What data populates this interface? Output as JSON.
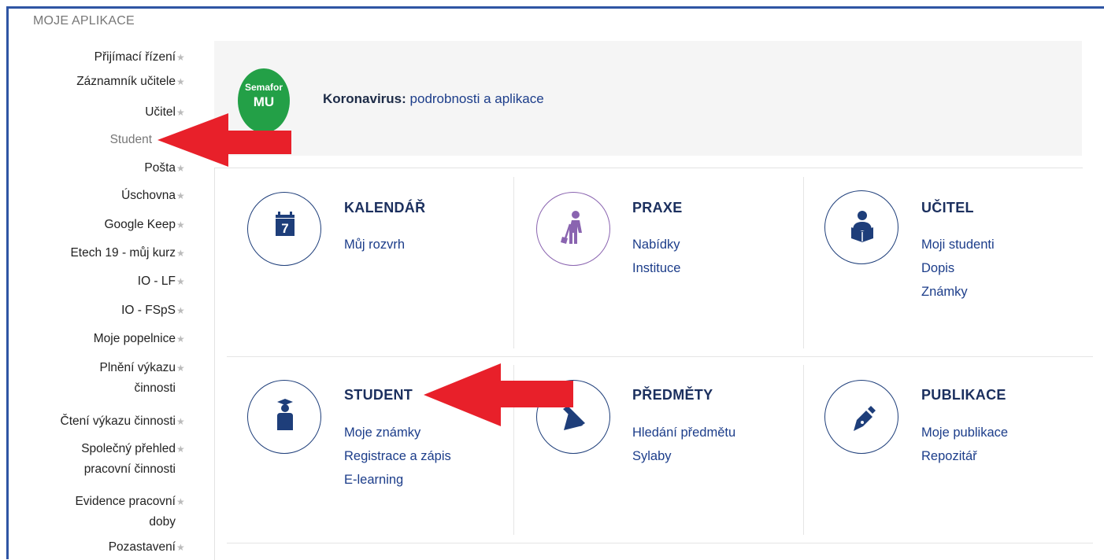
{
  "sidebar": {
    "title": "MOJE APLIKACE",
    "items": [
      {
        "label": "Přijímací řízení",
        "pin": true
      },
      {
        "label": "Záznamník učitele",
        "pin": true
      },
      {
        "label": "Učitel",
        "pin": true
      },
      {
        "label": "Student",
        "pin": false
      },
      {
        "label": "Pošta",
        "pin": true
      },
      {
        "label": "Úschovna",
        "pin": true
      },
      {
        "label": "Google Keep",
        "pin": true
      },
      {
        "label": "Etech 19 - můj kurz",
        "pin": true
      },
      {
        "label": "IO - LF",
        "pin": true
      },
      {
        "label": "IO - FSpS",
        "pin": true
      },
      {
        "label": "Moje popelnice",
        "pin": true
      },
      {
        "label": "Plnění výkazu",
        "label2": "činnosti",
        "pin": true
      },
      {
        "label": "Čtení výkazu činnosti",
        "pin": true
      },
      {
        "label": "Společný přehled",
        "label2": "pracovní činnosti",
        "pin": true
      },
      {
        "label": "Evidence pracovní",
        "label2": "doby",
        "pin": true
      },
      {
        "label": "Pozastavení",
        "pin": true
      }
    ],
    "pin_glyph": "★"
  },
  "banner": {
    "badge_line1": "Semafor",
    "badge_line2": "MU",
    "label": "Koronavirus:",
    "link": "podrobnosti a aplikace",
    "badge_color": "#23a047"
  },
  "tiles": [
    {
      "title": "KALENDÁŘ",
      "icon": "calendar-icon",
      "calendar_day": "7",
      "links": [
        "Můj rozvrh"
      ]
    },
    {
      "title": "PRAXE",
      "icon": "worker-icon",
      "links": [
        "Nabídky",
        "Instituce"
      ]
    },
    {
      "title": "UČITEL",
      "icon": "reading-person-icon",
      "links": [
        "Moji studenti",
        "Dopis",
        "Známky"
      ]
    },
    {
      "title": "STUDENT",
      "icon": "graduate-icon",
      "links": [
        "Moje známky",
        "Registrace a zápis",
        "E-learning"
      ]
    },
    {
      "title": "PŘEDMĚTY",
      "icon": "pencil-ruler-icon",
      "links": [
        "Hledání předmětu",
        "Sylaby"
      ]
    },
    {
      "title": "PUBLIKACE",
      "icon": "fountain-pen-icon",
      "links": [
        "Moje publikace",
        "Repozitář"
      ]
    }
  ],
  "colors": {
    "accent": "#1b2f5e",
    "link": "#1c3d8a",
    "frame": "#2f55a4",
    "arrow": "#e8202a"
  }
}
